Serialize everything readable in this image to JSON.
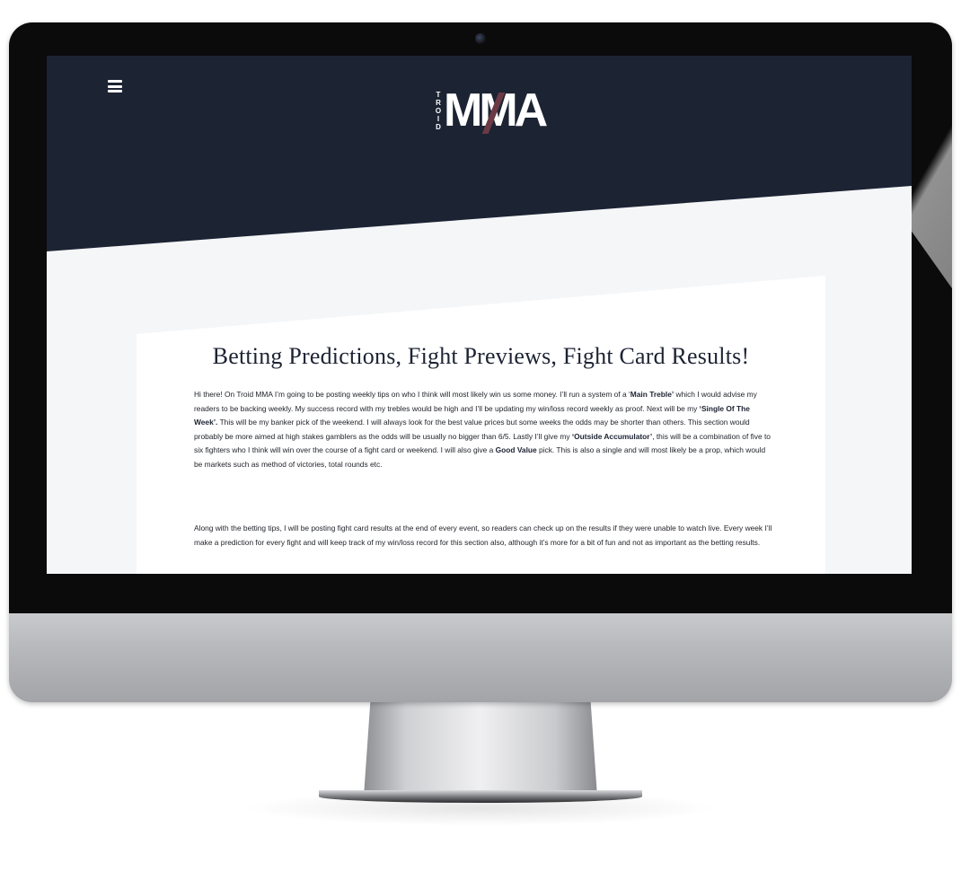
{
  "logo": {
    "side_text": [
      "T",
      "R",
      "O",
      "I",
      "D"
    ],
    "main_text": "MMA"
  },
  "icons": {
    "menu": "hamburger-menu-icon"
  },
  "colors": {
    "header_bg": "#1c2333",
    "page_bg": "#f4f6f8",
    "card_bg": "#ffffff",
    "logo_accent": "#6b3a45"
  },
  "main": {
    "title": "Betting Predictions, Fight Previews, Fight Card Results!",
    "paragraph1": {
      "t1": "Hi there! On Troid MMA I’m going to be posting weekly tips on who I think will most likely win us some money. I’ll run a system of a ‘",
      "b1": "Main Treble’",
      "t2": " which I would advise my readers to be backing weekly. My success record with my trebles would be high and I’ll be updating my win/loss record weekly as proof. Next will be my ",
      "b2": "‘Single Of The Week’.",
      "t3": " This will be my banker pick of the weekend. I will always look for the best value prices but some weeks the odds may be shorter than others. This section would probably be more aimed at high stakes gamblers as the odds will be usually no bigger than 6/5.  Lastly I’ll give my ",
      "b3": "‘Outside Accumulator’",
      "t4": ", this will be a combination of five to six fighters who I think will win over the course of a fight card or weekend.  I will also give a ",
      "b4": "Good Value",
      "t5": " pick. This is also a single and will most likely be a prop, which would be markets such as method of victories, total rounds etc."
    },
    "paragraph2": "Along with the betting tips, I will be posting fight card results at the end of every event, so readers can check up on the results if they were unable to watch live. Every week I’ll make a prediction for every fight and will keep track of my win/loss record for this section also, although it’s more for a bit of fun and not as important as the betting results."
  }
}
